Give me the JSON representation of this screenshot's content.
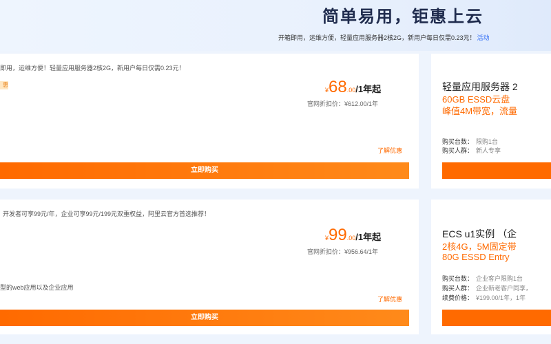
{
  "hero": {
    "title": "简单易用，钜惠上云",
    "subtitle": "开箱即用，运维方便，轻量应用服务器2核2G，新用户每日仅需0.23元！",
    "link": "活动"
  },
  "products": [
    {
      "description": "即用，运维方便！轻量应用服务器2核2G，新用户每日仅需0.23元！",
      "tag": "惠",
      "usecase": "",
      "price_currency": "¥",
      "price_integer": "68",
      "price_decimal": ".00",
      "price_unit": "/1年起",
      "original_price": "官网折扣价：¥612.00/1年",
      "learn_more": "了解优惠",
      "buy_label": "立即购买",
      "side_title": "轻量应用服务器 2",
      "side_spec_1": "60GB ESSD云盘",
      "side_spec_2": "峰值4M带宽，流量",
      "meta": [
        {
          "label": "购买台数：",
          "value": "限购1台"
        },
        {
          "label": "购买人群：",
          "value": "新人专享"
        }
      ]
    },
    {
      "description": "开发者可享99元/年，企业可享99元/199元双重权益，阿里云官方首选推荐！",
      "tag": "",
      "usecase": "型的web应用以及企业应用",
      "price_currency": "¥",
      "price_integer": "99",
      "price_decimal": ".00",
      "price_unit": "/1年起",
      "original_price": "官网折扣价：¥956.64/1年",
      "learn_more": "了解优惠",
      "buy_label": "立即购买",
      "side_title": "ECS u1实例 （企",
      "side_spec_1": "2核4G，5M固定带",
      "side_spec_2": "80G ESSD Entry",
      "meta": [
        {
          "label": "购买台数：",
          "value": "企业客户限购1台"
        },
        {
          "label": "购买人群：",
          "value": "企业新老客户同享，"
        },
        {
          "label": "续费价格：",
          "value": "¥199.00/1年，1年"
        }
      ]
    }
  ],
  "colors": {
    "accent": "#ff6a00",
    "hero_bg": "#eef4fd",
    "link": "#2f6bf5"
  }
}
